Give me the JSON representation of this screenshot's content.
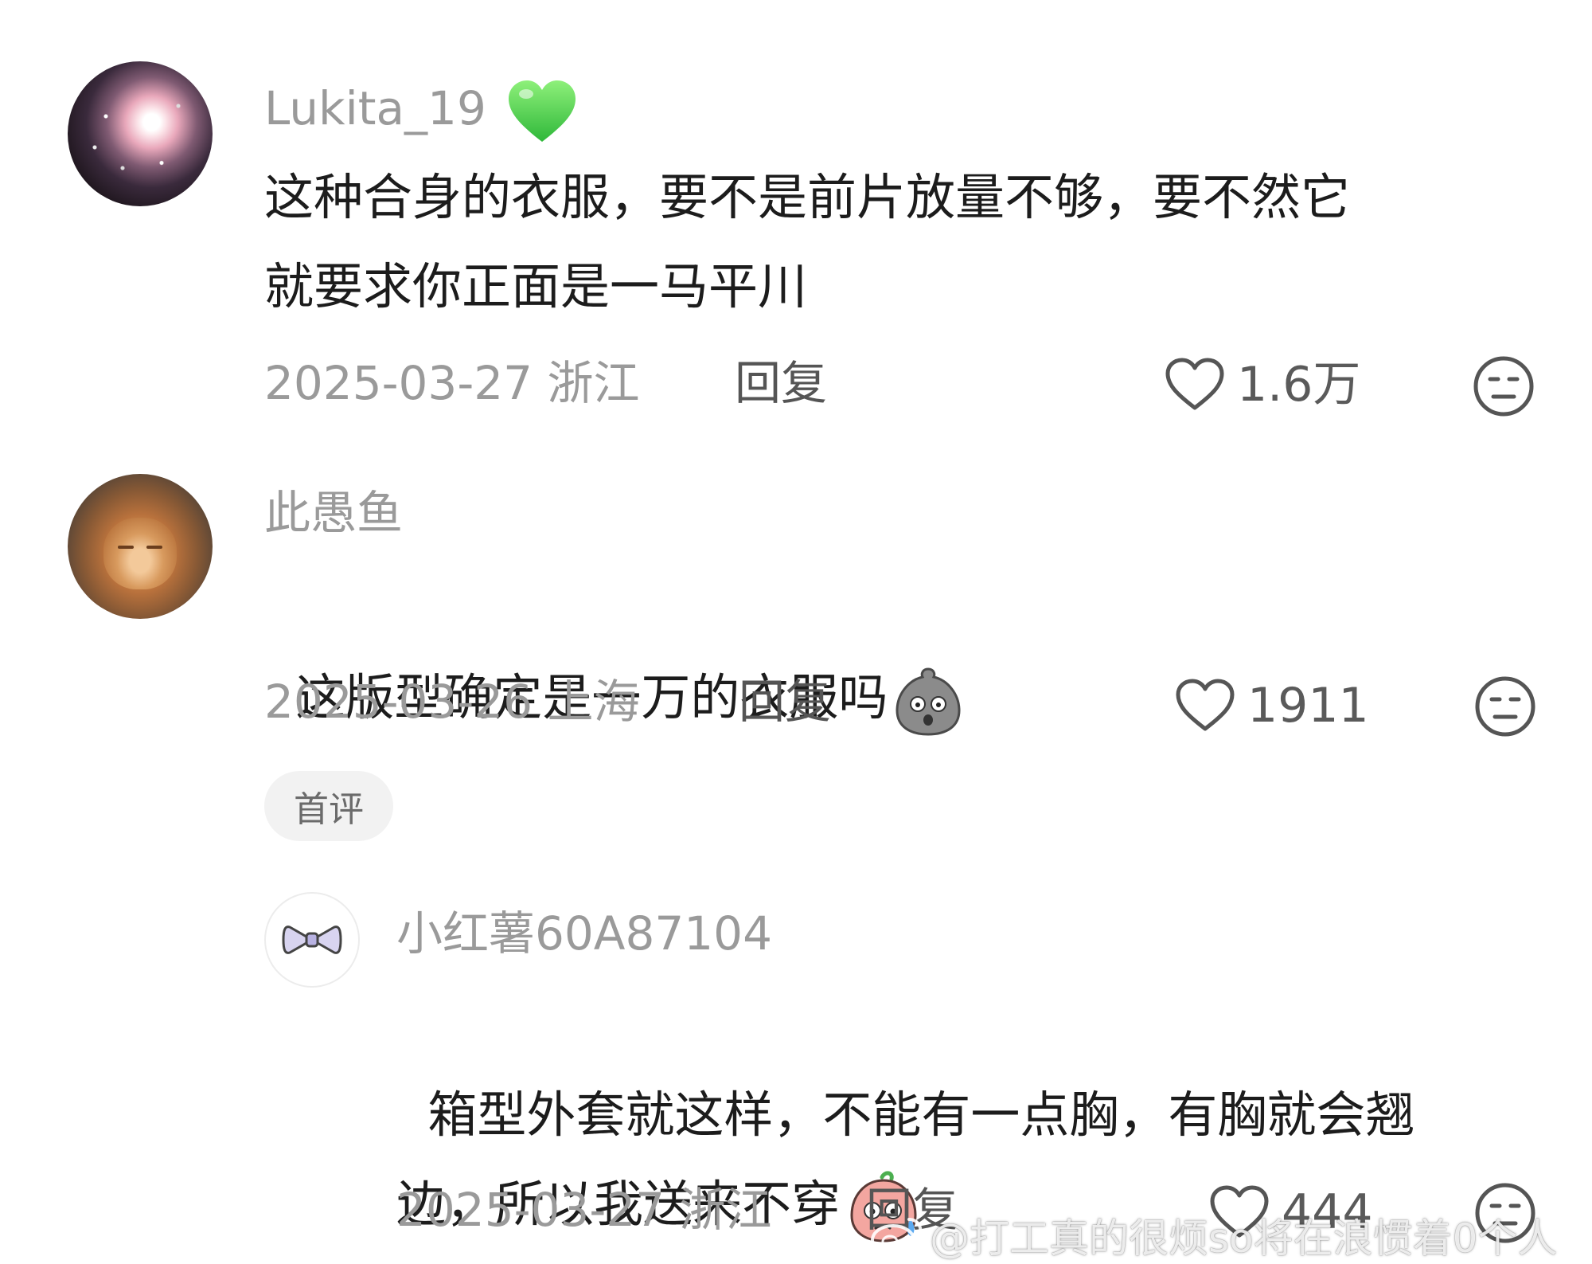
{
  "comments": [
    {
      "username": "Lukita_19",
      "badge_icon": "green-heart",
      "text": "这种合身的衣服，要不是前片放量不够，要不然它\n就要求你正面是一马平川",
      "date": "2025-03-27",
      "location": "浙江",
      "reply_label": "回复",
      "likes": "1.6万"
    },
    {
      "username": "此愚鱼",
      "text": "这版型确定是一万的衣服吗",
      "date": "2025-03-26",
      "location": "上海",
      "reply_label": "回复",
      "likes": "1911",
      "tag": "首评"
    }
  ],
  "reply": {
    "username": "小红薯60A87104",
    "text": "箱型外套就这样，不能有一点胸，有胸就会翘\n边，所以我送来不穿",
    "date": "2025-03-27",
    "location": "浙江",
    "reply_label": "回复",
    "likes": "444"
  },
  "watermark": "@打工真的很烦so将在浪惯着0个人",
  "colors": {
    "secondary_text": "#9a9a9a",
    "primary_text": "#1c1c1c",
    "tag_bg": "#f2f2f2"
  }
}
